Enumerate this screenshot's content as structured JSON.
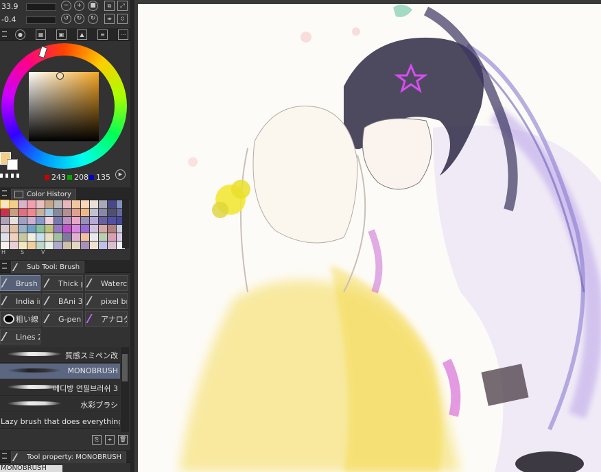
{
  "top": {
    "size_value": "33.9",
    "opacity_value": "-0.4"
  },
  "color": {
    "r": "243",
    "g": "208",
    "b": "135",
    "main_hex": "#f3d087"
  },
  "panels": {
    "color_history": "Color History",
    "sub_tool": "Sub Tool: Brush",
    "tool_property": "Tool property: MONOBRUSH"
  },
  "history_colors": [
    "#f0e6c8",
    "#f3d087",
    "#d9b4c8",
    "#f0a0b0",
    "#e8c0c0",
    "#c6a888",
    "#b8b8b8",
    "#e8b8b8",
    "#f0c8a0",
    "#f8d8b8",
    "#e8e0d8",
    "#a8a8b8",
    "#484888",
    "#8090c0",
    "#c83050",
    "#c8a080",
    "#e07080",
    "#f08890",
    "#c8b0a0",
    "#a8c8e0",
    "#888898",
    "#b09090",
    "#e0a090",
    "#f0b888",
    "#c0c0d0",
    "#8888a8",
    "#505070",
    "#6868a0",
    "#b0a0b8",
    "#e8e0e0",
    "#a0a0c0",
    "#d0b0d0",
    "#8898c8",
    "#f0d0e0",
    "#7878b0",
    "#c090c0",
    "#e8a8c8",
    "#9890b8",
    "#b8a8d8",
    "#6860a0",
    "#5050a8",
    "#4848a0",
    "#d8c8d0",
    "#e0c0a0",
    "#98b0c8",
    "#70a0c8",
    "#88c0a0",
    "#c0c080",
    "#9878c0",
    "#c050d0",
    "#d888e0",
    "#9868d8",
    "#d0c0e0",
    "#d8a8a8",
    "#b08080",
    "#c8d0e0",
    "#e0e0e8",
    "#f0d0c0",
    "#c8c8a0",
    "#f0f0e0",
    "#c8e0f0",
    "#e8e0c0",
    "#a0c0a0",
    "#8078a0",
    "#e0b0d0",
    "#f0c0a0",
    "#e8e8f0",
    "#b8d0b0",
    "#d8a0b0",
    "#e0c8e8",
    "#f8f0f0",
    "#e8d0d8",
    "#f0e8c0",
    "#f0d0a0",
    "#c0d8c8",
    "#e8f0e8",
    "#b0a8d0",
    "#d0c0a8",
    "#e0d8c0",
    "#a890b8",
    "#f0e0d0",
    "#c0c0e8",
    "#d8c0d0",
    "#f0f0f8"
  ],
  "history_tabs": [
    "H",
    "S",
    "V"
  ],
  "brush_buttons": [
    {
      "label": "Brush I",
      "selected": true
    },
    {
      "label": "Thick p",
      "selected": false
    },
    {
      "label": "Waterc",
      "selected": false
    },
    {
      "label": "India in",
      "selected": false
    },
    {
      "label": "BAni 3",
      "selected": false
    },
    {
      "label": "pixel bri",
      "selected": false
    },
    {
      "label": "粗い線",
      "selected": false
    },
    {
      "label": "G-pen",
      "selected": false
    },
    {
      "label": "アナログ",
      "selected": false
    },
    {
      "label": "Lines 2",
      "selected": false
    }
  ],
  "brush_list": [
    {
      "label": "質感スミペン改",
      "selected": false
    },
    {
      "label": "MONOBRUSH",
      "selected": true
    },
    {
      "label": "메디방 연필브러쉬 3",
      "selected": false
    },
    {
      "label": "水彩ブラシ",
      "selected": false
    },
    {
      "label": "Lazy brush that does everything/主ii",
      "selected": false
    }
  ],
  "tool_property_name": "MONOBRUSH"
}
